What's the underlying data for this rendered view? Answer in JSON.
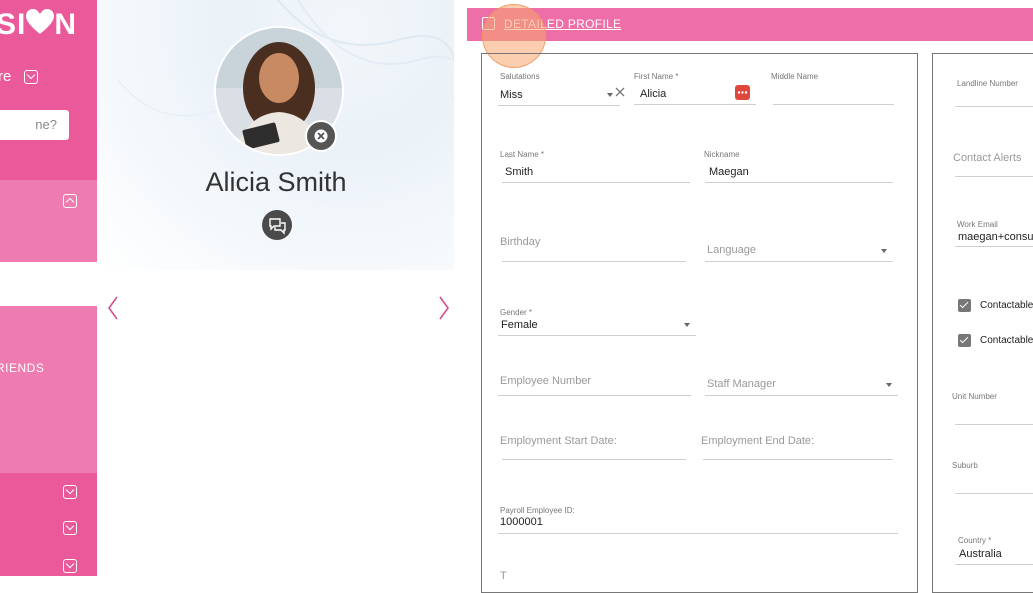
{
  "sidebar": {
    "logo_left": "SI",
    "logo_right": "N",
    "more_label": "re",
    "search_placeholder": "ne?",
    "friends_label": "RIENDS"
  },
  "profile": {
    "name": "Alicia Smith"
  },
  "detailed_profile": {
    "title": "DETAILED PROFILE",
    "fields": {
      "salutations_label": "Salutations",
      "salutations_value": "Miss",
      "first_name_label": "First Name *",
      "first_name_value": "Alicia",
      "middle_name_label": "Middle Name",
      "last_name_label": "Last Name *",
      "last_name_value": "Smith",
      "nickname_label": "Nickname",
      "nickname_value": "Maegan",
      "birthday_placeholder": "Birthday",
      "language_placeholder": "Language",
      "gender_label": "Gender *",
      "gender_value": "Female",
      "employee_number_placeholder": "Employee Number",
      "staff_manager_placeholder": "Staff Manager",
      "employment_start_placeholder": "Employment Start Date:",
      "employment_end_placeholder": "Employment End Date:",
      "payroll_label": "Payroll Employee ID:",
      "payroll_value": "1000001",
      "cut_off_label": "T"
    },
    "right_fields": {
      "landline_label": "Landline Number",
      "contact_alerts_placeholder": "Contact Alerts",
      "work_email_label": "Work Email",
      "work_email_value": "maegan+consu",
      "contactable_1": "Contactable",
      "contactable_2": "Contactable",
      "unit_number_label": "Unit Number",
      "suburb_label": "Suburb",
      "country_label": "Country *",
      "country_value": "Australia"
    }
  },
  "colors": {
    "sidebar": "#ea5a9b",
    "sidebar_light": "#ee7cb0",
    "header": "#ee6fa8",
    "arrow": "#d0508e"
  }
}
